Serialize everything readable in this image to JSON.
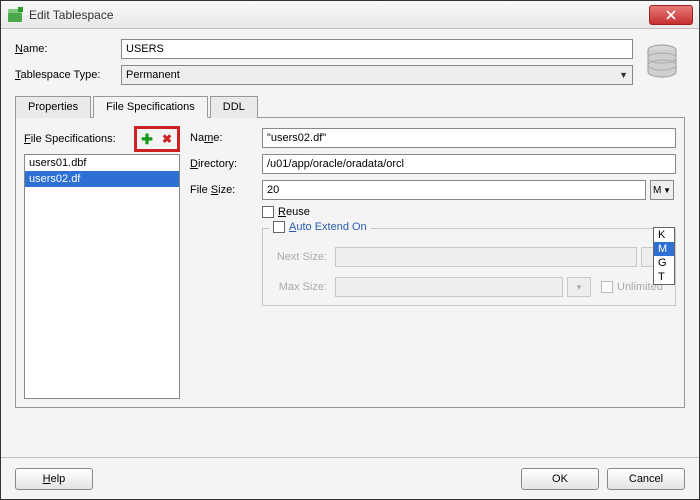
{
  "window": {
    "title": "Edit Tablespace"
  },
  "fields": {
    "name_label": "Name:",
    "name_underline": "N",
    "name_value": "USERS",
    "type_label": "Tablespace Type:",
    "type_underline": "T",
    "type_value": "Permanent"
  },
  "tabs": {
    "properties": "Properties",
    "filespecs": "File Specifications",
    "ddl": "DDL",
    "active": "filespecs"
  },
  "filespec": {
    "list_label": "File Specifications:",
    "list_underline": "F",
    "files": [
      "users01.dbf",
      "users02.df"
    ],
    "selected_index": 1,
    "name_label": "Name:",
    "name_underline_char": "m",
    "name_value": "\"users02.df\"",
    "dir_label": "Directory:",
    "dir_underline": "D",
    "dir_value": "/u01/app/oracle/oradata/orcl",
    "size_label": "File Size:",
    "size_underline": "S",
    "size_value": "20",
    "size_unit": "M",
    "reuse_label": "Reuse",
    "reuse_underline": "R",
    "auto_extend_label": "Auto Extend On",
    "auto_extend_underline": "A",
    "next_size_label": "Next Size:",
    "max_size_label": "Max Size:",
    "unlimited_label": "Unlimited"
  },
  "unit_options": [
    "K",
    "M",
    "G",
    "T"
  ],
  "unit_selected": "M",
  "buttons": {
    "help": "Help",
    "ok": "OK",
    "cancel": "Cancel"
  }
}
